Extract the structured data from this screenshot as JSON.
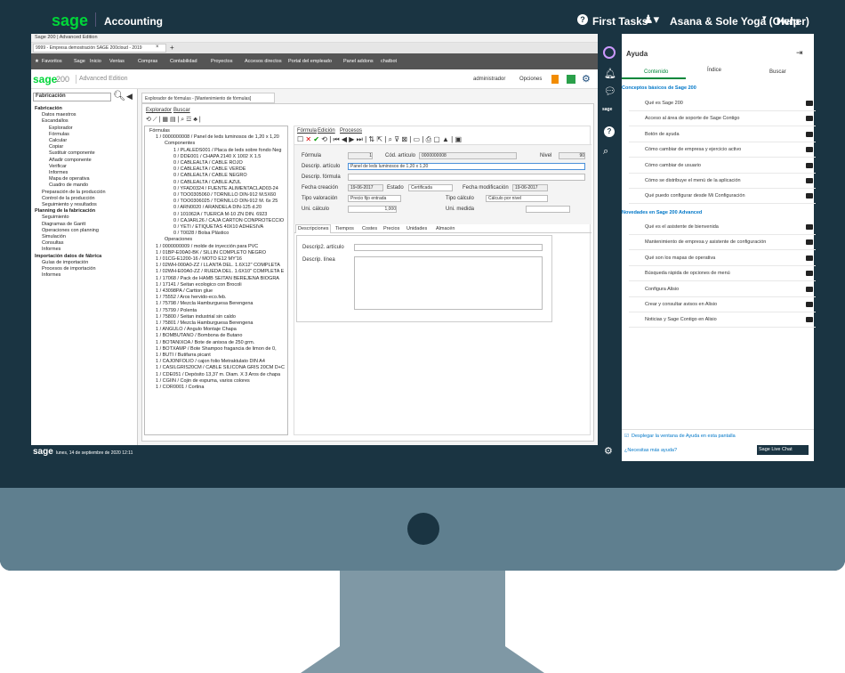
{
  "topbar": {
    "brand": "sage",
    "product": "Accounting",
    "first_tasks": "First Tasks",
    "user": "Asana & Sole Yoga (Owner)",
    "help": "Help"
  },
  "browser": {
    "title": "Sage 200 | Advanced Edition",
    "tab": "9999 - Empresa demostración SAGE 200cloud - 2019",
    "bookmarks": [
      "Favoritos",
      "Sage",
      "Inicio",
      "Ventas",
      "Compras",
      "Contabilidad",
      "Proyectos",
      "Accesos directos",
      "Portal del empleado",
      "Panel addons",
      "chatbot"
    ]
  },
  "app": {
    "logo": "sage",
    "version": "200",
    "edition": "Advanced Edition",
    "user": "administrador",
    "options": "Opciones"
  },
  "nav": {
    "module": "Fabricación",
    "items": [
      "Fabricación",
      "Datos maestros",
      "Escandallos",
      "Explorador",
      "Fórmulas",
      "Calcular",
      "Copiar",
      "Sustituir componente",
      "Añadir componente",
      "Verificar",
      "Informes",
      "Mapa de operativa",
      "Cuadro de mando",
      "Preparación de la producción",
      "Control de la producción",
      "Seguimiento y resultados",
      "Planning de la fabricación",
      "Seguimiento",
      "Diagramas de Gantt",
      "Operaciones con planning",
      "Simulación",
      "Consultas",
      "Informes",
      "Importación datos de fábrica",
      "Guías de importación",
      "Procesos de importación",
      "Informes"
    ]
  },
  "explorer": {
    "title": "Explorador de fórmulas - [Mantenimiento de fórmulas]",
    "menu": [
      "Explorador",
      "Buscar"
    ],
    "tree": [
      "Fórmulas",
      "1 / 0000000008 / Panel de leds luminosos de 1,20 x 1,20",
      "Componentes",
      "1 / PLALEDS001 / Placa de leds sobre fondo Neg",
      "0 / DDE001 / CHAPA 2140 X 1002 X 1.5",
      "0 / CABLEALTA / CABLE ROJO",
      "0 / CABLEALTA / CABLE VERDE",
      "0 / CABLEALTA / CABLE NEGRO",
      "0 / CABLEALTA / CABLE AZUL",
      "0 / YFAD0324 / FUENTE ALIMENTACLAD03-24",
      "0 / TOO0305060 / TORNILLO DIN-912 M.5X60",
      "0 / TOO0306025 / TORNILLO DIN-912 M. 6x 25",
      "0 / ARN0020 / ARANDELA DIN-125 d.20",
      "0 / 101062A / TUERCA M-10 ZN DIN. 6923",
      "0 / CAJARL26 / CAJA CARTON CONPROTECCIO",
      "0 / YETI / ETIQUETAS 40X10 ADHESIVA",
      "0 / T0028 / Bolsa Plástico",
      "Operaciones",
      "1 / 0000000009 / molde de inyección para PVC",
      "1 / 01BP-E00A0-BK / SILLIN COMPLETO NEGRO",
      "1 / 01CG-E1200-16 / MOTO E12 MY'16",
      "1 / 02WH-000A0-ZZ / LLANTA DEL. 1.6X12\" COMPLETA",
      "1 / 02WH-E00A0-ZZ / RUEDA DEL. 1.6X10\" COMPLETA E",
      "1 / 17068 / Pack de HAMB SEITAN BEREJENA BIOGRA",
      "1 / 17141 / Seitan ecologico con Brocoli",
      "1 / 43098PA / Cartton glue",
      "1 / 75552 / Aros hervido-eco.feb.",
      "1 / 75798 / Mezcla Hamburguesa Berengena",
      "1 / 75799 / Polenta",
      "1 / 75800 / Seitan industrial sin caldo",
      "1 / 75801 / Mezcla Hamburguesa Berengena",
      "1 / ANGULO / Angulo Montaje Chapa",
      "1 / BOMBUTANO / Bombona de Butano",
      "1 / BOTANIXOA / Bote de anisoa de 250 grm.",
      "1 / BOTXAMP / Bote Shampoo fragancia de limon de 0,",
      "1 / BUTI / Butifarra picant",
      "1 / CAJONFOLIO / cajon folio Metraktulato DIN A4",
      "1 / CASILGRIS20CM / CABLE SILICONA GRIS 20CM D+C",
      "1 / CDE051 / Depósito 13,37 m. Diam. X 3 Aros de chapa",
      "1 / CGIIN / Cojin de espuma, varios colores",
      "1 / COR0001 / Cortina"
    ]
  },
  "form": {
    "menu": [
      "Fórmula",
      "Edición",
      "Procesos"
    ],
    "labels": {
      "formula": "Fórmula",
      "cod": "Cód. artículo",
      "nivel": "Nivel",
      "descrip": "Descrip. artículo",
      "descrip_formula": "Descrip. fórmula",
      "fecha_creacion": "Fecha creación",
      "estado": "Estado",
      "fecha_mod": "Fecha modificación",
      "tipo_val": "Tipo valoración",
      "tipo_calc": "Tipo cálculo",
      "uni_calc": "Uni. cálculo",
      "uni_medida": "Uni. medida"
    },
    "values": {
      "formula": "1",
      "cod": "0000000008",
      "nivel": "90",
      "descrip": "Panel de leds luminosos de 1,20 x 1,20",
      "fecha_creacion": "19-06-2017",
      "estado": "Certificada",
      "fecha_mod": "19-06-2017",
      "tipo_val": "Precio fijo entrada",
      "tipo_calc": "Cálculo por nivel",
      "uni_calc": "1,000"
    },
    "tabs": [
      "Descripciones",
      "Tiempos",
      "Costes",
      "Precios",
      "Unidades",
      "Almacén"
    ],
    "desc2": "Descrip2. artículo",
    "desc_linea": "Descrip. línea"
  },
  "status": {
    "logo": "sage",
    "date": "lunes, 14 de septiembre de 2020  12:11"
  },
  "help": {
    "title": "Ayuda",
    "tabs": [
      "Contenido",
      "Índice",
      "Buscar"
    ],
    "section1": "Conceptos básicos de Sage 200",
    "items1": [
      "Qué es Sage 200",
      "Acceso al área de soporte de Sage Contigo",
      "Botón de ayuda",
      "Cómo cambiar de empresa y ejercicio activo",
      "Cómo cambiar de usuario",
      "Cómo se distribuye el menú de la aplicación",
      "Qué puedo configurar desde Mi Configuración"
    ],
    "section2": "Novedades en Sage 200 Advanced",
    "items2": [
      "Qué es el asistente de bienvenida",
      "Mantenimiento de empresa y asistente de configuración",
      "Qué son los mapas de operativa",
      "Búsqueda rápida de opciones de menú",
      "Configura Alisio",
      "Crear y consultar avisos en Alisio",
      "Noticias y Sage Contigo en Alisio"
    ],
    "checkbox": "Desplegar la ventana de Ayuda en esta pantalla",
    "need_help": "¿Necesitas más ayuda?",
    "live_chat": "Sage Live Chat"
  },
  "colors": {
    "brand": "#00d639",
    "frame": "#1a3442",
    "chin": "#5f7f8f",
    "accent": "#0077c8"
  }
}
